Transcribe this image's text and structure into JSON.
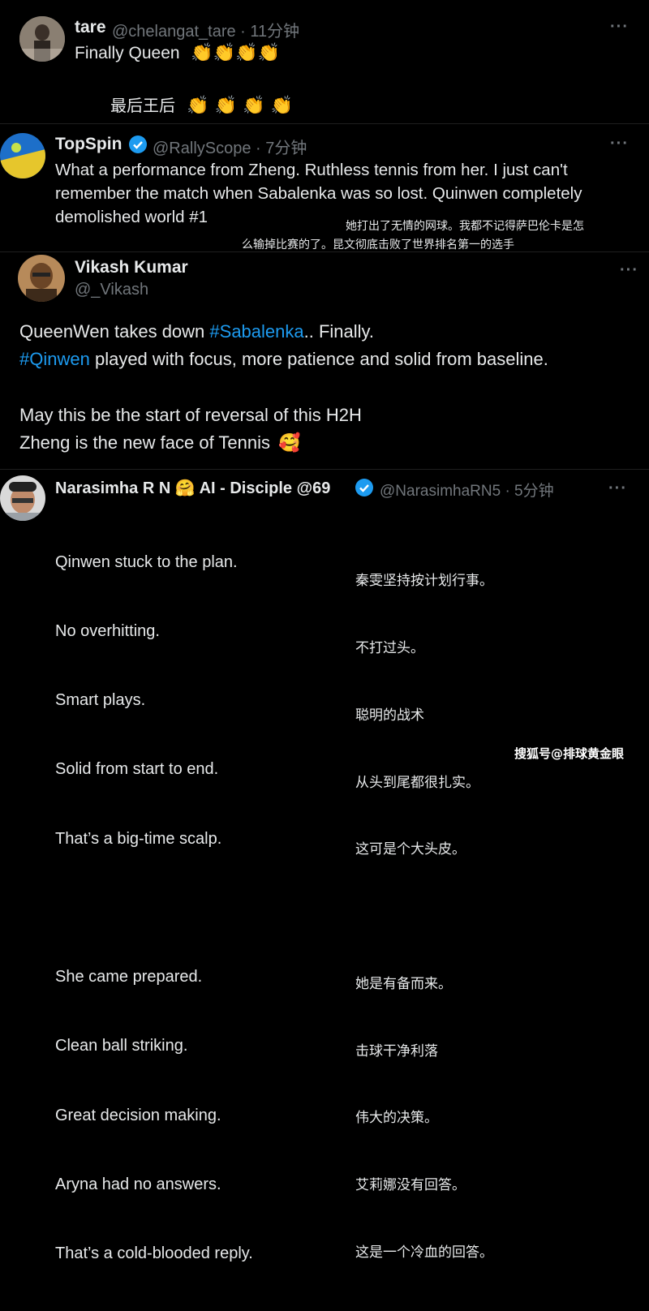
{
  "tweet1": {
    "name": "tare",
    "handle": "@chelangat_tare · 11分钟",
    "text": "Finally Queen",
    "translation": "最后王后"
  },
  "tweet2": {
    "name": "TopSpin",
    "handle": "@RallyScope · 7分钟",
    "lines": [
      "What a performance from Zheng. Ruthless tennis from her. I just can't",
      "remember the match when Sabalenka was so lost. Quinwen completely",
      "demolished world #1"
    ],
    "translation_lines": [
      "她打出了无情的网球。我都不记得萨巴伦卡是怎",
      "么输掉比赛的了。昆文彻底击败了世界排名第一的选手"
    ]
  },
  "tweet3": {
    "name": "Vikash Kumar",
    "handle": "@_Vikash",
    "line1_pre": "QueenWen takes down ",
    "line1_tag": "#Sabalenka",
    "line1_post": ".. Finally.",
    "line2_tag": "#Qinwen",
    "line2_post": " played with focus, more patience and solid from baseline.",
    "line3": "May this be the start of reversal of this H2H",
    "line4": "Zheng is the new face of Tennis"
  },
  "tweet4": {
    "name_pre": "Narasimha R N",
    "name_post": "AI - Disciple @69",
    "handle": "@NarasimhaRN5 · 5分钟",
    "lines": [
      "Qinwen stuck to the plan.",
      "No overhitting.",
      "Smart plays.",
      "Solid from start to end.",
      "That’s a big-time scalp.",
      "",
      "She came prepared.",
      "Clean ball striking.",
      "Great decision making.",
      "Aryna had no answers.",
      "That’s a cold-blooded reply."
    ],
    "translation_lines": [
      "秦雯坚持按计划行事。",
      "不打过头。",
      "聪明的战术",
      "从头到尾都很扎实。",
      "这可是个大头皮。",
      "",
      "她是有备而来。",
      "击球干净利落",
      "伟大的决策。",
      "艾莉娜没有回答。",
      "这是一个冷血的回答。"
    ]
  },
  "watermark": "搜狐号@排球黄金眼",
  "more_label": "···",
  "colors": {
    "link": "#1d9bf0",
    "muted": "#71767b",
    "verified": "#1d9bf0"
  }
}
